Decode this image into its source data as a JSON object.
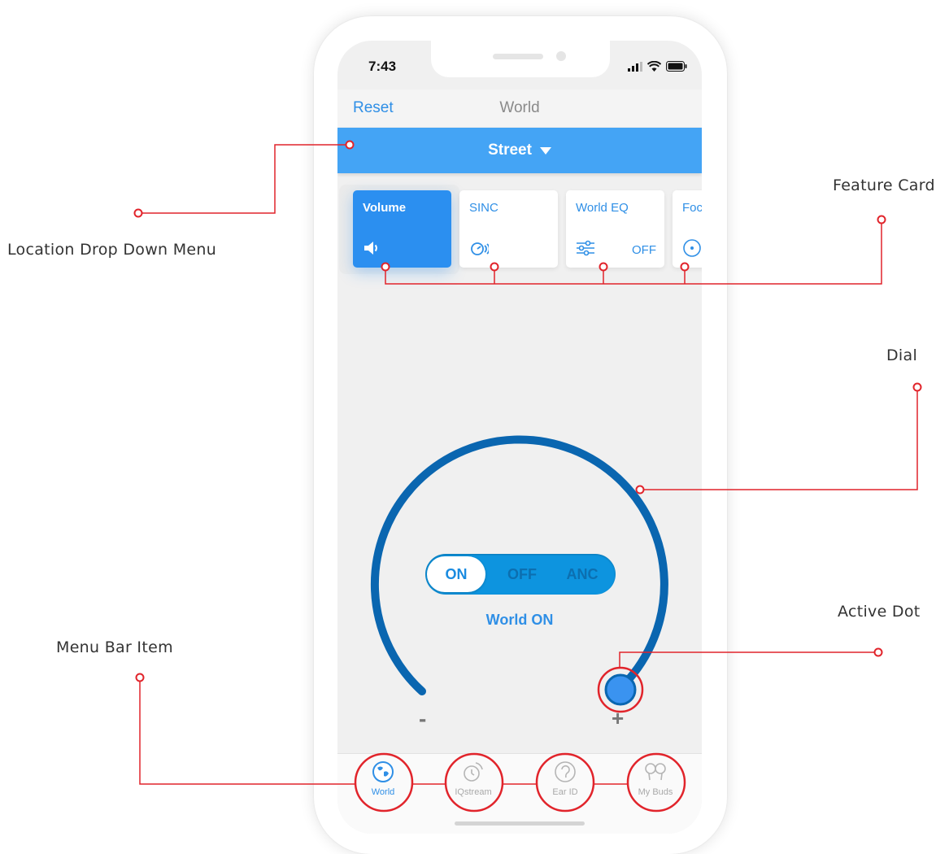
{
  "callouts": {
    "location_menu": "Location Drop Down Menu",
    "feature_card": "Feature Card",
    "dial": "Dial",
    "active_dot": "Active Dot",
    "menu_bar_item": "Menu Bar Item"
  },
  "status_bar": {
    "time": "7:43",
    "icons": [
      "signal-icon",
      "wifi-icon",
      "battery-icon"
    ]
  },
  "nav": {
    "left_button": "Reset",
    "title": "World"
  },
  "location": {
    "selected": "Street"
  },
  "feature_cards": [
    {
      "title": "Volume",
      "icon": "speaker-icon",
      "status": "",
      "active": true
    },
    {
      "title": "SINC",
      "icon": "sinc-icon",
      "status": ""
    },
    {
      "title": "World EQ",
      "icon": "equalizer-icon",
      "status": "OFF"
    },
    {
      "title": "Foc",
      "icon": "focus-icon",
      "status": ""
    }
  ],
  "mode_toggle": {
    "options": [
      "ON",
      "OFF",
      "ANC"
    ],
    "selected": "ON"
  },
  "world_state": "World ON",
  "dial": {
    "min_label": "-",
    "max_label": "+"
  },
  "tabbar": [
    {
      "label": "World",
      "icon": "globe-icon",
      "current": true
    },
    {
      "label": "IQstream",
      "icon": "iqstream-icon"
    },
    {
      "label": "Ear ID",
      "icon": "ear-icon"
    },
    {
      "label": "My Buds",
      "icon": "earbuds-icon"
    }
  ],
  "colors": {
    "accent": "#2f8fe6",
    "location_bar": "#44a4f5",
    "dial": "#0a66b0",
    "callout": "#e1242b"
  }
}
